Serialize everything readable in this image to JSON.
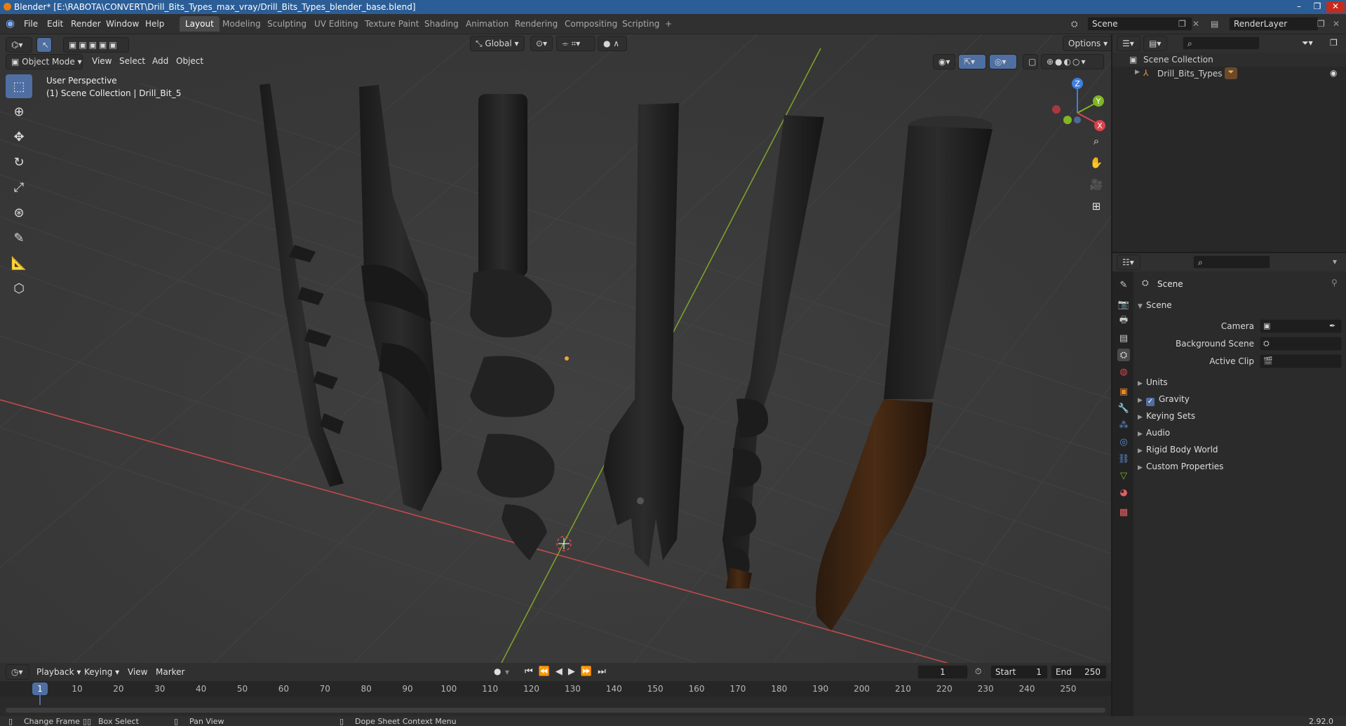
{
  "window": {
    "title": "Blender* [E:\\RABOTA\\CONVERT\\Drill_Bits_Types_max_vray/Drill_Bits_Types_blender_base.blend]"
  },
  "menu": [
    "File",
    "Edit",
    "Render",
    "Window",
    "Help"
  ],
  "workspaces": [
    "Layout",
    "Modeling",
    "Sculpting",
    "UV Editing",
    "Texture Paint",
    "Shading",
    "Animation",
    "Rendering",
    "Compositing",
    "Scripting",
    "+"
  ],
  "scene": {
    "name": "Scene",
    "render_layer": "RenderLayer"
  },
  "header": {
    "transform_orientation": "Global",
    "options": "Options"
  },
  "viewport_menu": {
    "mode": "Object Mode",
    "items": [
      "View",
      "Select",
      "Add",
      "Object"
    ]
  },
  "overlay": {
    "line1": "User Perspective",
    "line2": "(1) Scene Collection | Drill_Bit_5"
  },
  "gizmo": {
    "x": "X",
    "y": "Y",
    "z": "Z"
  },
  "outliner": {
    "root": "Scene Collection",
    "item": "Drill_Bits_Types"
  },
  "properties": {
    "title": "Scene",
    "section": "Scene",
    "fields": [
      "Camera",
      "Background Scene",
      "Active Clip"
    ],
    "panels": [
      "Units",
      "Gravity",
      "Keying Sets",
      "Audio",
      "Rigid Body World",
      "Custom Properties"
    ]
  },
  "timeline": {
    "menus": [
      "Playback",
      "Keying",
      "View",
      "Marker"
    ],
    "current_frame": "1",
    "start_label": "Start",
    "start": "1",
    "end_label": "End",
    "end": "250",
    "ticks": [
      "1",
      "10",
      "20",
      "30",
      "40",
      "50",
      "60",
      "70",
      "80",
      "90",
      "100",
      "110",
      "120",
      "130",
      "140",
      "150",
      "160",
      "170",
      "180",
      "190",
      "200",
      "210",
      "220",
      "230",
      "240",
      "250"
    ]
  },
  "statusbar": {
    "change_frame": "Change Frame",
    "box_select": "Box Select",
    "pan_view": "Pan View",
    "context_menu": "Dope Sheet Context Menu",
    "version": "2.92.0"
  },
  "colors": {
    "accent": "#4f6fa2",
    "title_bar": "#2b5d96",
    "x_axis": "#d9434b",
    "y_axis": "#7fb623",
    "z_axis": "#3f7fe0"
  }
}
